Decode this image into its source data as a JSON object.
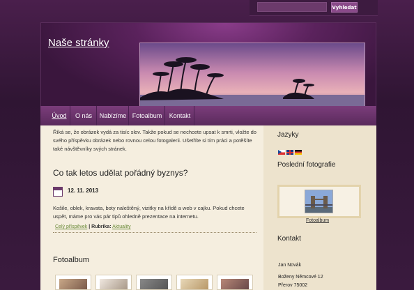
{
  "search": {
    "placeholder": "",
    "button_label": "Vyhledat"
  },
  "header": {
    "site_title": "Naše stránky"
  },
  "nav": {
    "items": [
      "Úvod",
      "O nás",
      "Nabízíme",
      "Fotoalbum",
      "Kontakt"
    ]
  },
  "intro": {
    "text": "Říká se, že obrázek vydá za tisíc slov. Takže pokud se nechcete upsat k smrti, vložte do svého příspěvku obrázek nebo rovnou celou fotogalerii. Ušetříte si tím práci a potěšíte také návštěvníky svých stránek."
  },
  "post": {
    "title": "Co tak letos udělat pořádný byznys?",
    "date": "12. 11. 2013",
    "body": "Košile, oblek, kravata, boty naleštěný, vizitky na křídě a web v cajku. Pokud chcete uspět, máme pro vás pár tipů ohledně prezentace na internetu.",
    "read_more": "Celý příspěvek",
    "rubric_label": "| Rubrika:",
    "rubric_value": "Aktuality"
  },
  "gallery": {
    "title": "Fotoalbum"
  },
  "sidebar": {
    "languages_title": "Jazyky",
    "flags": [
      "czech-flag-icon",
      "uk-flag-icon",
      "german-flag-icon"
    ],
    "photos_title": "Poslední fotografie",
    "photo_link": "Fotoalbum",
    "contact_title": "Kontakt",
    "contact_lines": [
      "Jan Novák",
      "Boženy Němcové 12",
      "Přerov 75002"
    ]
  }
}
